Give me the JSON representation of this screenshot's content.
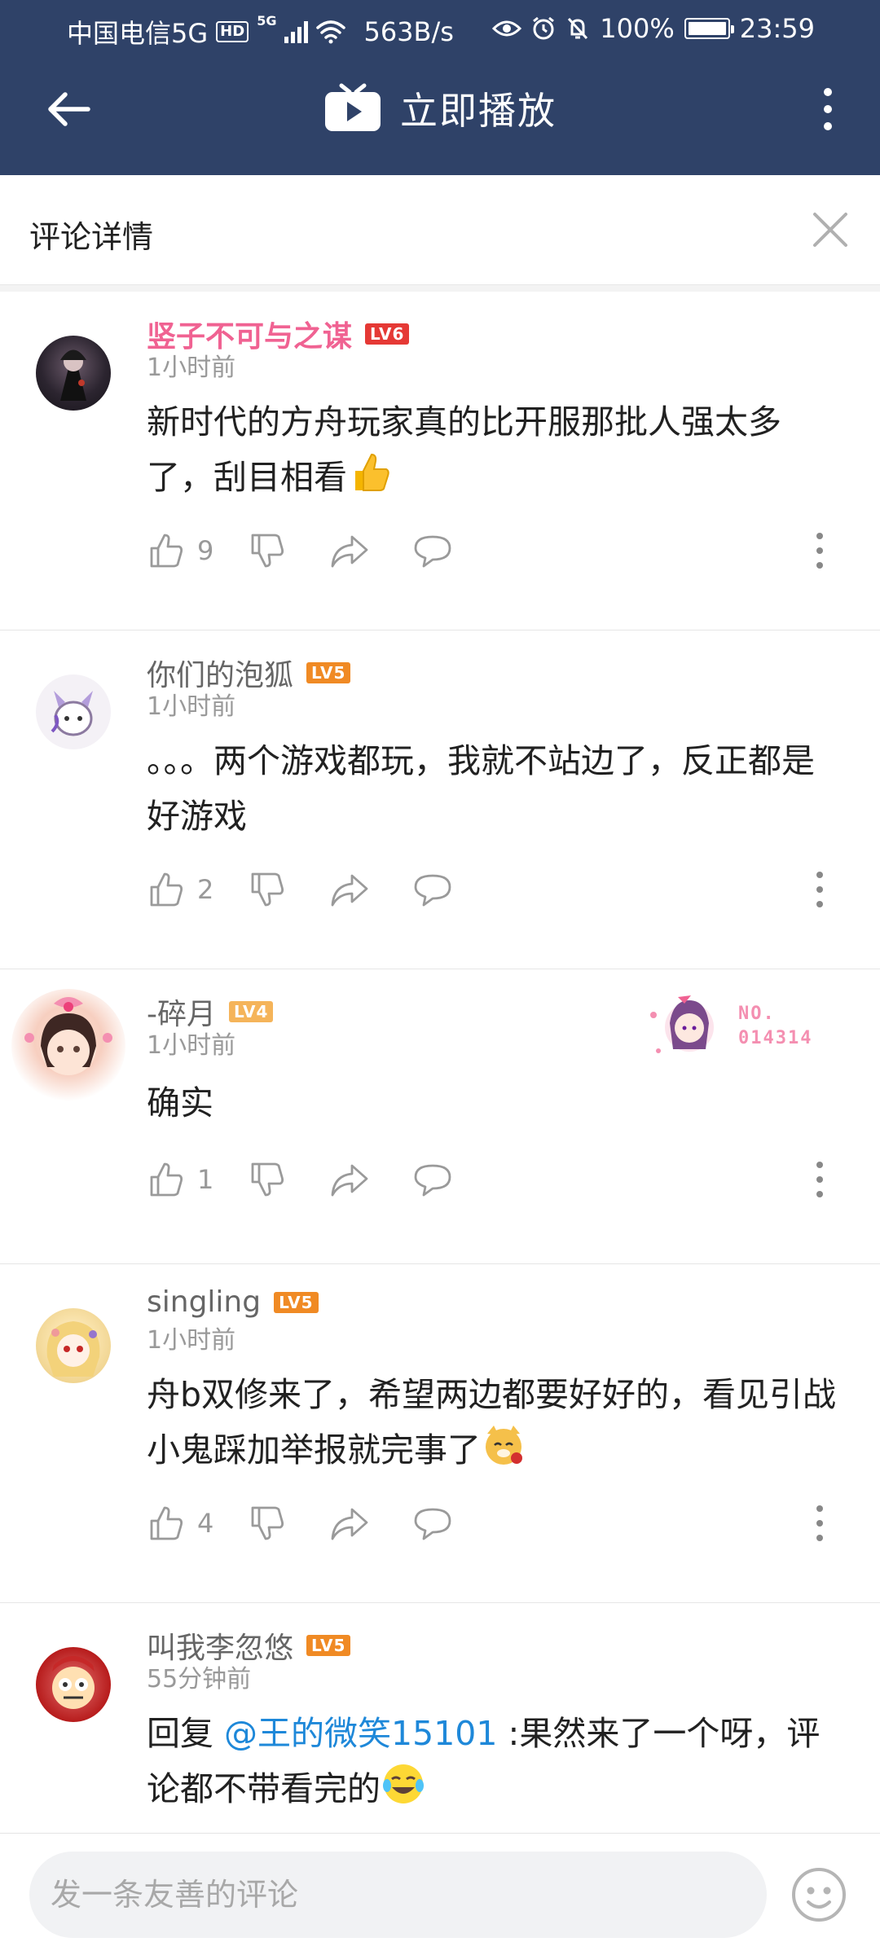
{
  "status_bar": {
    "carrier": "中国电信5G",
    "hd": "HD",
    "net_type": "5G",
    "speed": "563B/s",
    "battery": "100%",
    "battery_level": 1.0,
    "time": "23:59"
  },
  "app_bar": {
    "title": "立即播放",
    "back_icon": "arrow-left-icon",
    "menu_icon": "more-vert-icon",
    "logo_icon": "tv-play-icon"
  },
  "sheet": {
    "title": "评论详情",
    "close_icon": "close-icon"
  },
  "comments": [
    {
      "username": "竖子不可与之谋",
      "level": "LV6",
      "level_color": "#e53935",
      "time": "1小时前",
      "text": "新时代的方舟玩家真的比开服那批人强太多了，刮目相看",
      "emoji": "thumbs-up-emoji",
      "likes": "9"
    },
    {
      "username": "你们的泡狐",
      "level": "LV5",
      "level_color": "#f08a24",
      "time": "1小时前",
      "text": "。。。两个游戏都玩，我就不站边了，反正都是好游戏",
      "likes": "2"
    },
    {
      "username": "-碎月",
      "level": "LV4",
      "level_color": "#f5b45a",
      "time": "1小时前",
      "text": "确实",
      "likes": "1",
      "badge_number": "NO.\n014314"
    },
    {
      "username": "singling",
      "level": "LV5",
      "level_color": "#f08a24",
      "time": "1小时前",
      "text": "舟b双修来了，希望两边都要好好的，看见引战小鬼踩加举报就完事了",
      "emoji": "doge-rose-emoji",
      "likes": "4"
    },
    {
      "username": "叫我李忽悠",
      "level": "LV5",
      "level_color": "#f08a24",
      "time": "55分钟前",
      "reply_prefix": "回复 ",
      "mention": "@王的微笑15101",
      "text": " :果然来了一个呀，评论都不带看完的",
      "emoji": "tears-of-joy-emoji"
    }
  ],
  "input": {
    "placeholder": "发一条友善的评论",
    "emoji_button_icon": "emoji-face-icon"
  },
  "colors": {
    "app_bar": "#2f4268",
    "vip_name": "#f06292",
    "mention": "#1e88d9"
  }
}
